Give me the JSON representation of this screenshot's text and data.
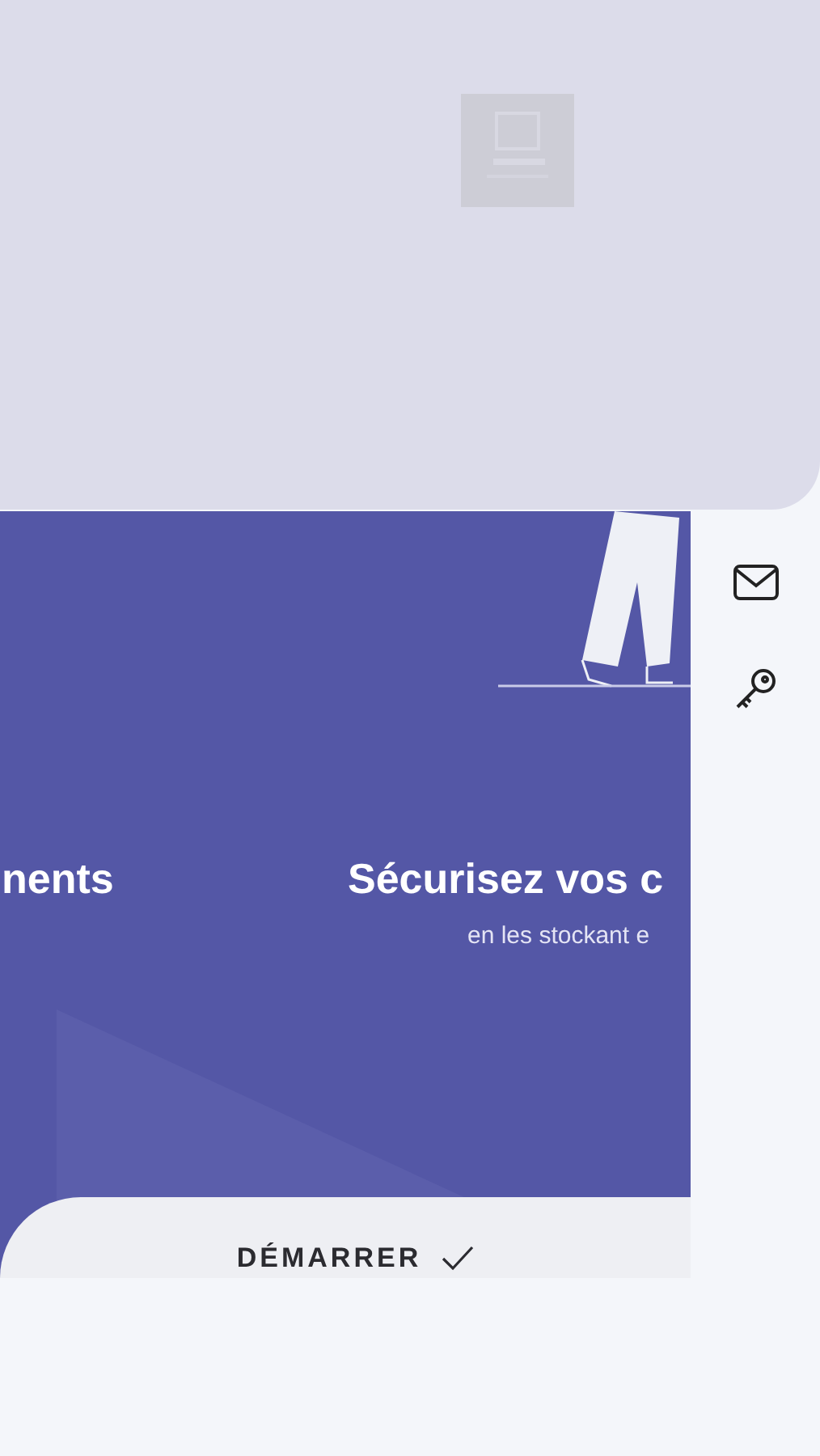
{
  "slides": [
    {
      "title": "nents"
    },
    {
      "title": "Sécurisez vos c",
      "subtitle": "en les stockant e"
    }
  ],
  "start_button": {
    "label": "DÉMARRER"
  }
}
